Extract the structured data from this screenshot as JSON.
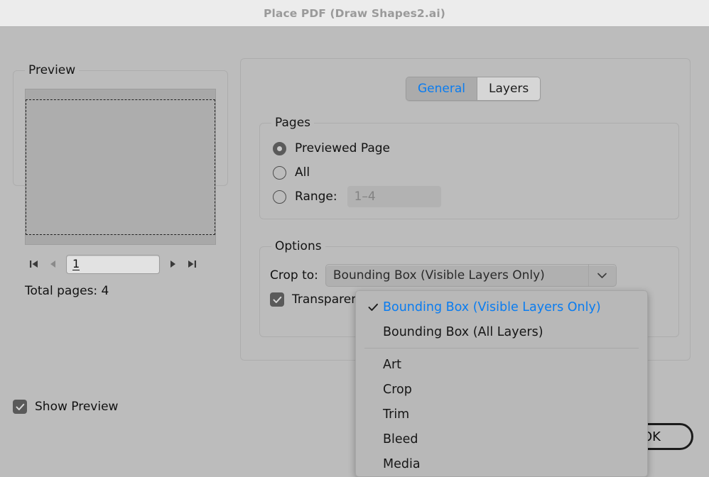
{
  "window": {
    "title": "Place PDF (Draw Shapes2.ai)"
  },
  "preview": {
    "group_title": "Preview",
    "page_value": "1",
    "total_pages_label": "Total pages: 4",
    "nav": {
      "first_icon": "first-page-icon",
      "prev_icon": "previous-page-icon",
      "next_icon": "next-page-icon",
      "last_icon": "last-page-icon"
    }
  },
  "tabs": [
    {
      "label": "General",
      "active": true
    },
    {
      "label": "Layers",
      "active": false
    }
  ],
  "pages": {
    "group_title": "Pages",
    "options": [
      {
        "label": "Previewed Page",
        "checked": true
      },
      {
        "label": "All",
        "checked": false
      },
      {
        "label": "Range:",
        "checked": false
      }
    ],
    "range_placeholder": "1–4"
  },
  "options": {
    "group_title": "Options",
    "crop_to_label": "Crop to:",
    "crop_to_value": "Bounding Box (Visible Layers Only)",
    "transparent_label": "Transparent",
    "transparent_checked": true
  },
  "dropdown": {
    "items": [
      {
        "label": "Bounding Box (Visible Layers Only)",
        "selected": true
      },
      {
        "label": "Bounding Box (All Layers)",
        "selected": false
      },
      {
        "separator": true
      },
      {
        "label": "Art",
        "selected": false
      },
      {
        "label": "Crop",
        "selected": false
      },
      {
        "label": "Trim",
        "selected": false
      },
      {
        "label": "Bleed",
        "selected": false
      },
      {
        "label": "Media",
        "selected": false
      }
    ]
  },
  "footer": {
    "show_preview_label": "Show Preview",
    "show_preview_checked": true,
    "ok_label": "OK"
  },
  "colors": {
    "dialog_bg": "#bcbcbc",
    "titlebar_bg": "#ececec",
    "accent": "#0a7cf0",
    "title_text": "#9a9a9a"
  }
}
